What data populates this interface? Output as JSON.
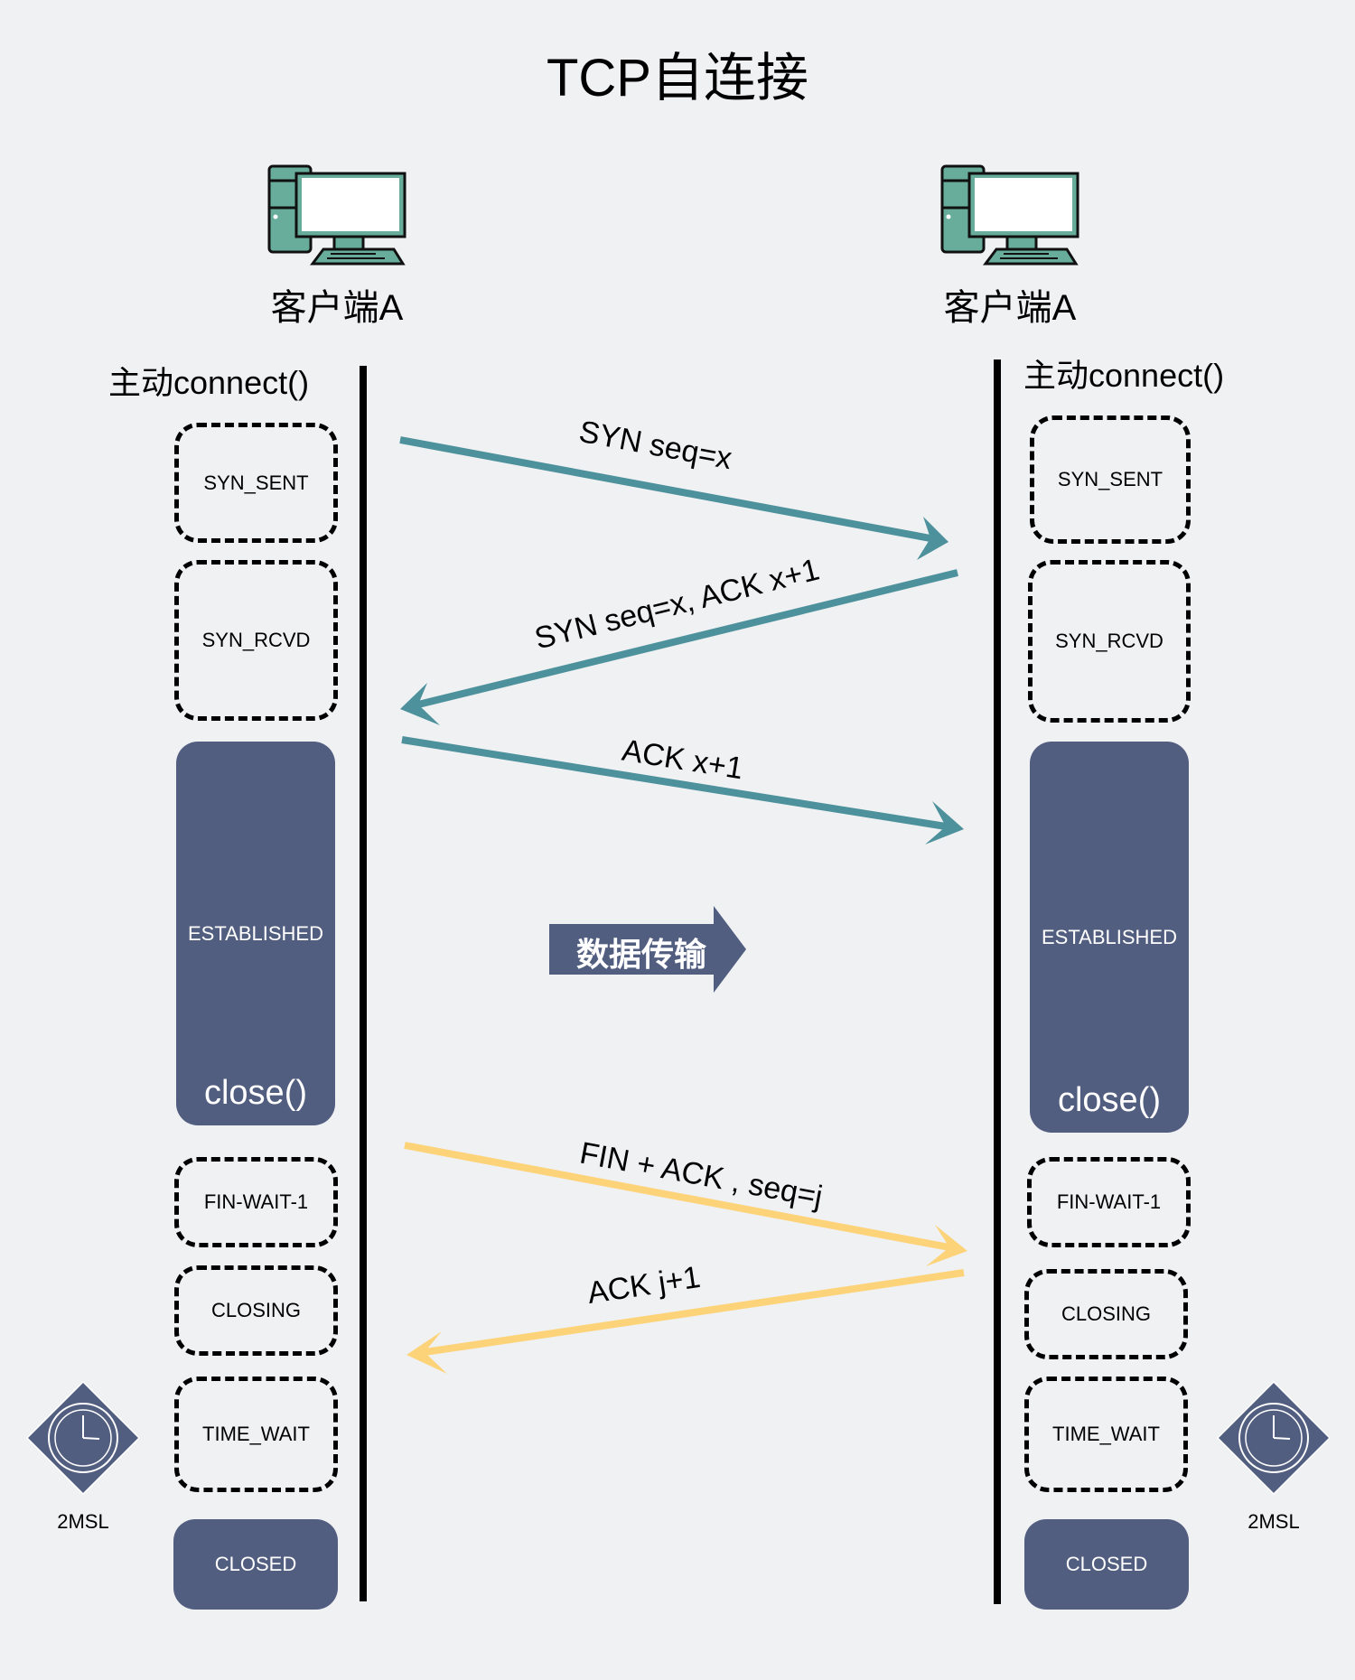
{
  "title": "TCP自连接",
  "colors": {
    "background": "#f0f1f3",
    "state_fill": "#525e80",
    "handshake_arrow": "#4c919b",
    "close_arrow": "#fdd37a",
    "computer_teal": "#68ad9c"
  },
  "left": {
    "client_label": "客户端A",
    "connect_label": "主动connect()",
    "states": {
      "syn_sent": "SYN_SENT",
      "syn_rcvd": "SYN_RCVD",
      "established": "ESTABLISHED",
      "close_call": "close()",
      "fin_wait_1": "FIN-WAIT-1",
      "closing": "CLOSING",
      "time_wait": "TIME_WAIT",
      "closed": "CLOSED"
    },
    "timer_label": "2MSL"
  },
  "right": {
    "client_label": "客户端A",
    "connect_label": "主动connect()",
    "states": {
      "syn_sent": "SYN_SENT",
      "syn_rcvd": "SYN_RCVD",
      "established": "ESTABLISHED",
      "close_call": "close()",
      "fin_wait_1": "FIN-WAIT-1",
      "closing": "CLOSING",
      "time_wait": "TIME_WAIT",
      "closed": "CLOSED"
    },
    "timer_label": "2MSL"
  },
  "messages": [
    {
      "label": "SYN  seq=x",
      "direction": "left-to-right",
      "phase": "handshake"
    },
    {
      "label": "SYN seq=x, ACK x+1",
      "direction": "right-to-left",
      "phase": "handshake"
    },
    {
      "label": "ACK  x+1",
      "direction": "left-to-right",
      "phase": "handshake"
    },
    {
      "label": "FIN + ACK , seq=j",
      "direction": "left-to-right",
      "phase": "close"
    },
    {
      "label": "ACK j+1",
      "direction": "right-to-left",
      "phase": "close"
    }
  ],
  "data_transfer_label": "数据传输"
}
